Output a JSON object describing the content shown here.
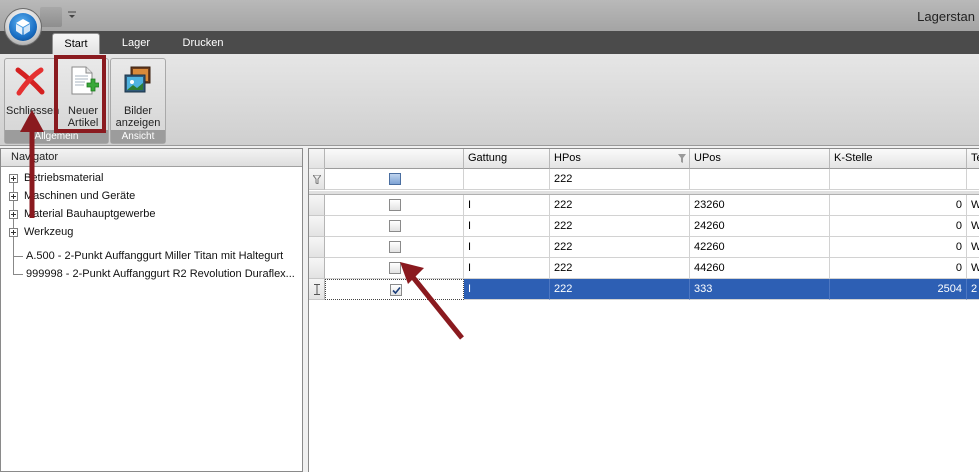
{
  "window": {
    "title": "Lagerstan"
  },
  "tabs": [
    {
      "label": "Start",
      "active": true
    },
    {
      "label": "Lager",
      "active": false
    },
    {
      "label": "Drucken",
      "active": false
    }
  ],
  "ribbon": {
    "buttons": {
      "close": {
        "label": "Schliessen",
        "icon": "red-x-icon"
      },
      "new_article": {
        "label_line1": "Neuer",
        "label_line2": "Artikel",
        "icon": "new-document-icon"
      },
      "show_images": {
        "label_line1": "Bilder",
        "label_line2": "anzeigen",
        "icon": "pictures-icon"
      }
    },
    "groups": {
      "left": "Allgemein",
      "view": "Ansicht"
    }
  },
  "navigator": {
    "title": "Navigator",
    "items": [
      {
        "label": "Betriebsmaterial",
        "expandable": true
      },
      {
        "label": "Maschinen und Geräte",
        "expandable": true
      },
      {
        "label": "Material Bauhauptgewerbe",
        "expandable": true
      },
      {
        "label": "Werkzeug",
        "expandable": true
      },
      {
        "label": "A.500 - 2-Punkt Auffanggurt Miller Titan mit Haltegurt",
        "expandable": false
      },
      {
        "label": "999998 - 2-Punkt Auffanggurt R2 Revolution Duraflex...",
        "expandable": false
      }
    ]
  },
  "grid": {
    "columns": [
      "",
      "Gattung",
      "HPos",
      "UPos",
      "K-Stelle",
      "Te"
    ],
    "filter": {
      "hpos": "222"
    },
    "rows": [
      {
        "checked": false,
        "gattung": "I",
        "hpos": "222",
        "upos": "23260",
        "kstelle": "0",
        "te": "W",
        "selected": false
      },
      {
        "checked": false,
        "gattung": "I",
        "hpos": "222",
        "upos": "24260",
        "kstelle": "0",
        "te": "W",
        "selected": false
      },
      {
        "checked": false,
        "gattung": "I",
        "hpos": "222",
        "upos": "42260",
        "kstelle": "0",
        "te": "W",
        "selected": false
      },
      {
        "checked": false,
        "gattung": "I",
        "hpos": "222",
        "upos": "44260",
        "kstelle": "0",
        "te": "W",
        "selected": false
      },
      {
        "checked": true,
        "gattung": "I",
        "hpos": "222",
        "upos": "333",
        "kstelle": "2504",
        "te": "2",
        "selected": true
      }
    ]
  },
  "colors": {
    "annotation": "#8a1a1f",
    "selection": "#2d5fb4",
    "tabstrip": "#4b4b4b"
  }
}
